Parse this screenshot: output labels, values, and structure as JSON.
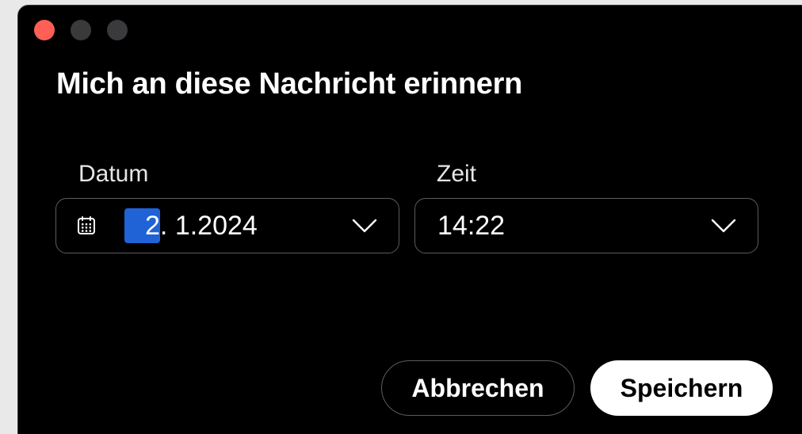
{
  "window": {
    "traffic_lights": {
      "close_color": "#ff5f57",
      "inactive_color": "#3a3a3c"
    }
  },
  "dialog": {
    "title": "Mich an diese Nachricht erinnern",
    "date": {
      "label": "Datum",
      "icon": "calendar-icon",
      "day_segment": "2",
      "rest": ". 1.2024",
      "selected_segment_color": "#1f63d6"
    },
    "time": {
      "label": "Zeit",
      "value": "14:22"
    },
    "buttons": {
      "cancel": "Abbrechen",
      "save": "Speichern"
    }
  }
}
